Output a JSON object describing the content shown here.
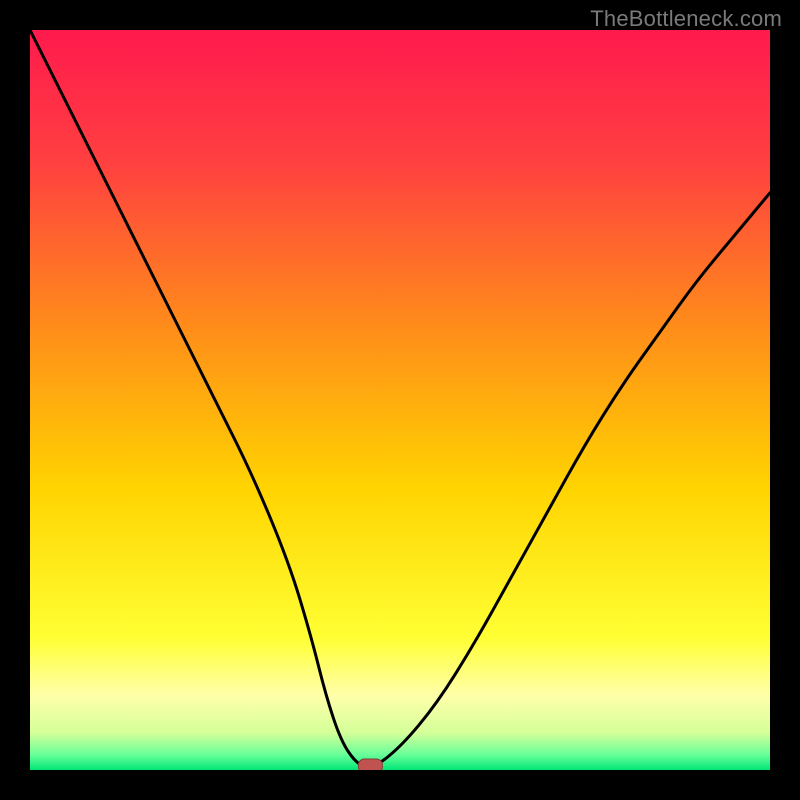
{
  "watermark": "TheBottleneck.com",
  "chart_data": {
    "type": "line",
    "title": "",
    "xlabel": "",
    "ylabel": "",
    "xlim": [
      0,
      100
    ],
    "ylim": [
      0,
      100
    ],
    "grid": false,
    "legend": false,
    "background_gradient": {
      "top_color": "#ff1a4d",
      "mid_color": "#ffd400",
      "bottom_band_color": "#ffff99",
      "base_color": "#00e676"
    },
    "series": [
      {
        "name": "bottleneck-curve",
        "color": "#000000",
        "x": [
          0,
          5,
          10,
          15,
          20,
          25,
          30,
          35,
          38,
          40,
          42,
          44,
          46,
          50,
          55,
          60,
          65,
          70,
          75,
          80,
          85,
          90,
          95,
          100
        ],
        "y": [
          100,
          90,
          80,
          70,
          60,
          50,
          40,
          28,
          18,
          10,
          4,
          1,
          0,
          3,
          9,
          17,
          26,
          35,
          44,
          52,
          59,
          66,
          72,
          78
        ]
      }
    ],
    "marker": {
      "name": "optimal-point",
      "x": 46,
      "y": 0,
      "color": "#c0524f",
      "shape": "rounded-rect"
    }
  }
}
